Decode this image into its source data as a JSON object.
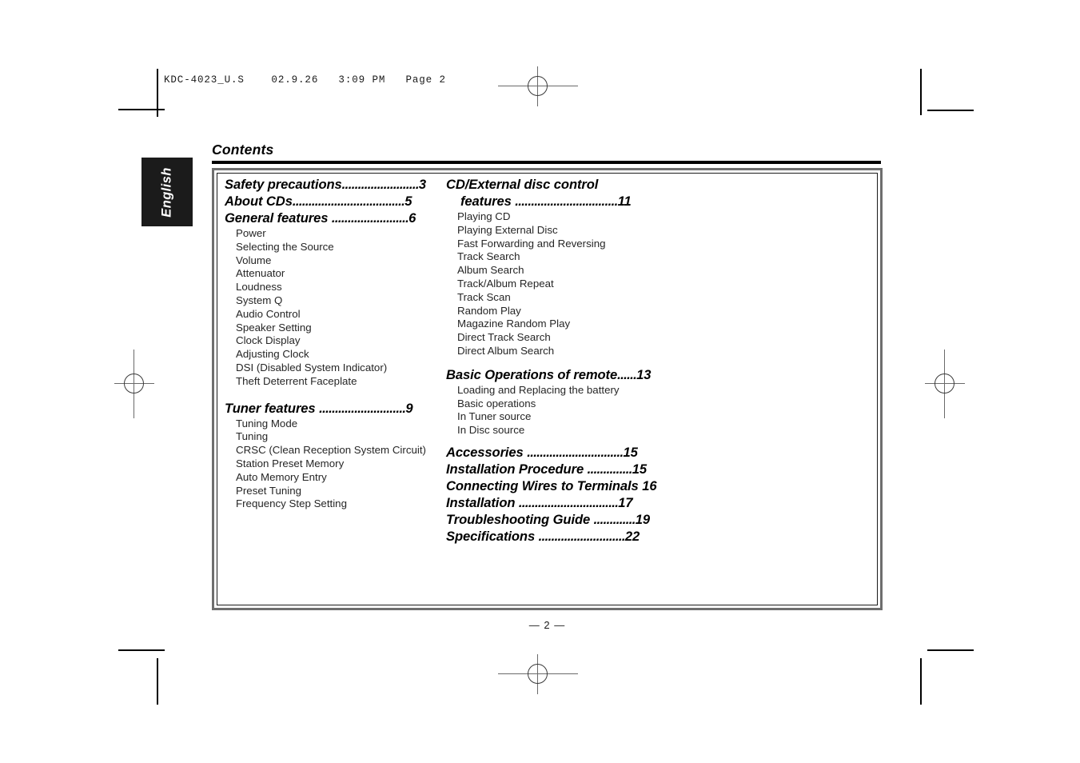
{
  "file_header": {
    "text": "KDC-4023_U.S    02.9.26   3:09 PM   Page 2"
  },
  "language_tab": {
    "label": "English"
  },
  "page_title": "Contents",
  "page_number": "— 2 —",
  "left_column": [
    {
      "type": "entry",
      "label": "Safety precautions",
      "dots": "........................",
      "page": "3"
    },
    {
      "type": "entry",
      "label": "About CDs",
      "dots": "...................................",
      "page": "5"
    },
    {
      "type": "entry",
      "label": "General features ",
      "dots": "........................",
      "page": "6"
    },
    {
      "type": "sub",
      "label": "Power"
    },
    {
      "type": "sub",
      "label": "Selecting the Source"
    },
    {
      "type": "sub",
      "label": "Volume"
    },
    {
      "type": "sub",
      "label": "Attenuator"
    },
    {
      "type": "sub",
      "label": "Loudness"
    },
    {
      "type": "sub",
      "label": "System Q"
    },
    {
      "type": "sub",
      "label": "Audio Control"
    },
    {
      "type": "sub",
      "label": "Speaker Setting"
    },
    {
      "type": "sub",
      "label": "Clock Display"
    },
    {
      "type": "sub",
      "label": "Adjusting Clock"
    },
    {
      "type": "sub",
      "label": "DSI (Disabled System Indicator)"
    },
    {
      "type": "sub",
      "label": "Theft Deterrent Faceplate"
    },
    {
      "type": "gap",
      "size": "md"
    },
    {
      "type": "entry",
      "label": "Tuner features ",
      "dots": "...........................",
      "page": "9"
    },
    {
      "type": "sub",
      "label": "Tuning Mode"
    },
    {
      "type": "sub",
      "label": "Tuning"
    },
    {
      "type": "sub",
      "label": "CRSC (Clean Reception System Circuit)"
    },
    {
      "type": "sub",
      "label": "Station Preset Memory"
    },
    {
      "type": "sub",
      "label": "Auto Memory Entry"
    },
    {
      "type": "sub",
      "label": "Preset Tuning"
    },
    {
      "type": "sub",
      "label": "Frequency Step Setting"
    }
  ],
  "right_column": [
    {
      "type": "entry-wrap",
      "label_line1": "CD/External disc control",
      "label_line2": "features ",
      "dots": "................................",
      "page": "11"
    },
    {
      "type": "sub",
      "label": "Playing CD"
    },
    {
      "type": "sub",
      "label": "Playing External Disc"
    },
    {
      "type": "sub",
      "label": "Fast Forwarding and Reversing"
    },
    {
      "type": "sub",
      "label": "Track Search"
    },
    {
      "type": "sub",
      "label": "Album Search"
    },
    {
      "type": "sub",
      "label": "Track/Album Repeat"
    },
    {
      "type": "sub",
      "label": "Track Scan"
    },
    {
      "type": "sub",
      "label": "Random Play"
    },
    {
      "type": "sub",
      "label": "Magazine Random Play"
    },
    {
      "type": "sub",
      "label": "Direct Track Search"
    },
    {
      "type": "sub",
      "label": "Direct Album Search"
    },
    {
      "type": "entry",
      "label": "Basic Operations of remote",
      "dots": "......",
      "page": "13"
    },
    {
      "type": "sub",
      "label": "Loading and Replacing the battery"
    },
    {
      "type": "sub",
      "label": "Basic operations"
    },
    {
      "type": "sub",
      "label": "In Tuner source"
    },
    {
      "type": "sub",
      "label": "In Disc source"
    },
    {
      "type": "gap",
      "size": "sm"
    },
    {
      "type": "entry",
      "label": "Accessories ",
      "dots": "..............................",
      "page": "15"
    },
    {
      "type": "entry",
      "label": "Installation Procedure ",
      "dots": "..............",
      "page": "15"
    },
    {
      "type": "entry",
      "label": "Connecting Wires to Terminals ",
      "dots": "",
      "page": "16"
    },
    {
      "type": "entry",
      "label": "Installation ",
      "dots": "...............................",
      "page": "17"
    },
    {
      "type": "entry",
      "label": "Troubleshooting Guide ",
      "dots": ".............",
      "page": "19"
    },
    {
      "type": "entry",
      "label": "Specifications ",
      "dots": "...........................",
      "page": "22"
    }
  ],
  "colors": {
    "frame_outer": "#6e6e6e",
    "frame_inner": "#1a1a1a",
    "tab_background": "#1b1b1b",
    "tab_text": "#ffffff"
  }
}
